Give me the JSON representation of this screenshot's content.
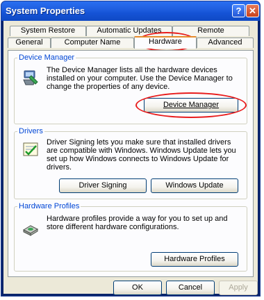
{
  "window": {
    "title": "System Properties"
  },
  "titlebar": {
    "help_glyph": "?",
    "close_glyph": "✕"
  },
  "tabs": {
    "row_back": [
      {
        "label": "System Restore"
      },
      {
        "label": "Automatic Updates"
      },
      {
        "label": "Remote"
      }
    ],
    "row_front": [
      {
        "label": "General"
      },
      {
        "label": "Computer Name"
      },
      {
        "label": "Hardware"
      },
      {
        "label": "Advanced"
      }
    ],
    "active": "Hardware"
  },
  "device_manager": {
    "legend": "Device Manager",
    "description": "The Device Manager lists all the hardware devices installed on your computer. Use the Device Manager to change the properties of any device.",
    "button_label": "Device Manager",
    "icon": "device-manager-icon"
  },
  "drivers": {
    "legend": "Drivers",
    "description": "Driver Signing lets you make sure that installed drivers are compatible with Windows. Windows Update lets you set up how Windows connects to Windows Update for drivers.",
    "signing_button_label": "Driver Signing",
    "update_button_label": "Windows Update",
    "icon": "driver-signing-icon"
  },
  "hardware_profiles": {
    "legend": "Hardware Profiles",
    "description": "Hardware profiles provide a way for you to set up and store different hardware configurations.",
    "button_label": "Hardware Profiles",
    "icon": "hardware-profiles-icon"
  },
  "footer": {
    "ok_label": "OK",
    "cancel_label": "Cancel",
    "apply_label": "Apply"
  },
  "annotations": {
    "color": "#e81c1c"
  }
}
